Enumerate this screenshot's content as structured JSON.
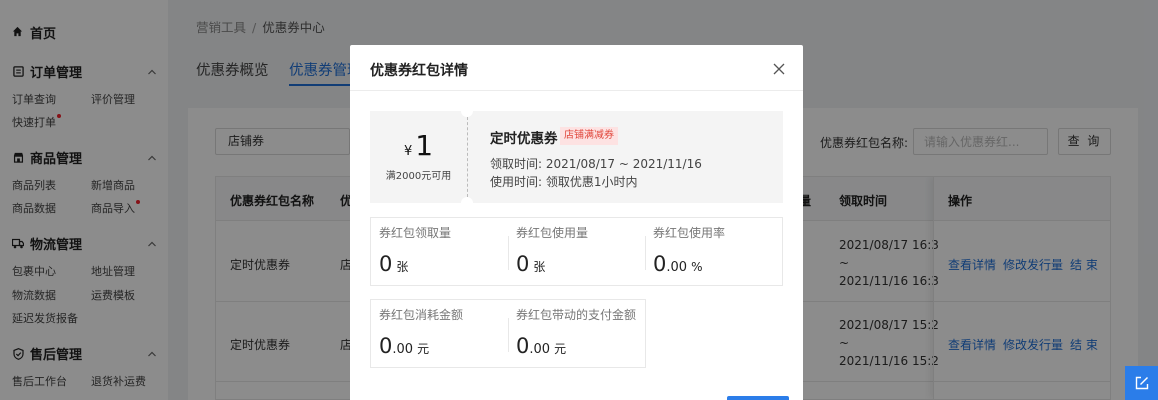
{
  "sidebar": {
    "home": "首页",
    "groups": [
      {
        "title": "订单管理",
        "items": [
          "订单查询",
          "评价管理",
          "快速打单"
        ]
      },
      {
        "title": "商品管理",
        "items": [
          "商品列表",
          "新增商品",
          "商品数据",
          "商品导入"
        ]
      },
      {
        "title": "物流管理",
        "items": [
          "包裹中心",
          "地址管理",
          "物流数据",
          "运费模板",
          "延迟发货报备"
        ]
      },
      {
        "title": "售后管理",
        "items": [
          "售后工作台",
          "退货补运费"
        ]
      }
    ]
  },
  "breadcrumb": {
    "parent": "营销工具",
    "separator": "/",
    "current": "优惠券中心"
  },
  "tabs": [
    {
      "label": "优惠券概览"
    },
    {
      "label": "优惠券管理"
    }
  ],
  "filters": {
    "select_value": "店铺券",
    "name_label": "优惠券红包名称:",
    "name_placeholder": "请输入优惠券红...",
    "query_button": "查 询"
  },
  "table": {
    "headers": [
      "优惠券红包名称",
      "优",
      "量",
      "领取时间",
      "操作"
    ],
    "rows": [
      {
        "name": "定时优惠券",
        "col2": "店",
        "time_start": "2021/08/17 16:3",
        "time_sep": "~",
        "time_end": "2021/11/16 16:3"
      },
      {
        "name": "定时优惠券",
        "col2": "店",
        "time_start": "2021/08/17 15:2",
        "time_sep": "~",
        "time_end": "2021/11/16 15:2"
      }
    ],
    "actions": [
      "查看详情",
      "修改发行量",
      "结 束"
    ]
  },
  "modal": {
    "title": "优惠券红包详情",
    "coupon": {
      "currency": "¥",
      "amount": "1",
      "condition": "满2000元可用",
      "name": "定时优惠券",
      "tag": "店铺满减券",
      "claim_time": "领取时间:  2021/08/17 ~ 2021/11/16",
      "use_time": "使用时间:  领取优惠1小时内"
    },
    "stats": [
      {
        "label": "券红包领取量",
        "value": "0",
        "decimal": "",
        "unit": "张"
      },
      {
        "label": "券红包使用量",
        "value": "0",
        "decimal": "",
        "unit": "张"
      },
      {
        "label": "券红包使用率",
        "value": "0",
        "decimal": ".00",
        "unit": "%"
      },
      {
        "label": "券红包消耗金额",
        "value": "0",
        "decimal": ".00",
        "unit": "元"
      },
      {
        "label": "券红包带动的支付金额",
        "value": "0",
        "decimal": ".00",
        "unit": "元"
      }
    ]
  },
  "colors": {
    "accent": "#1f6fd8",
    "button": "#2b7de9",
    "tag_bg": "#fde2e2",
    "tag_text": "#e0453a"
  }
}
